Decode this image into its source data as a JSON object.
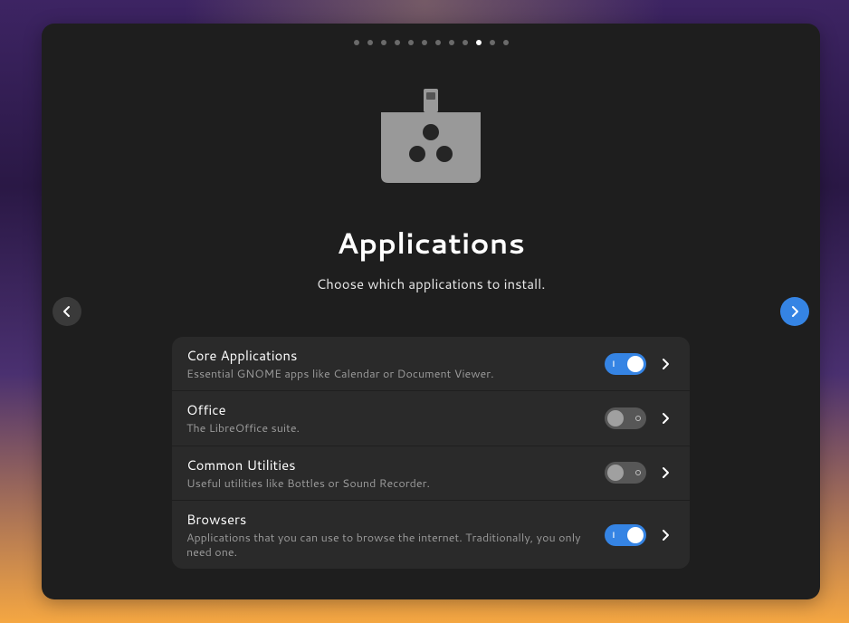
{
  "title": "Applications",
  "subtitle": "Choose which applications to install.",
  "page_indicator": {
    "total": 12,
    "active": 10
  },
  "rows": [
    {
      "title": "Core Applications",
      "desc": "Essential GNOME apps like Calendar or Document Viewer.",
      "enabled": true
    },
    {
      "title": "Office",
      "desc": "The LibreOffice suite.",
      "enabled": false
    },
    {
      "title": "Common Utilities",
      "desc": "Useful utilities like Bottles or Sound Recorder.",
      "enabled": false
    },
    {
      "title": "Browsers",
      "desc": "Applications that you can use to browse the internet. Traditionally, you only need one.",
      "enabled": true
    }
  ],
  "colors": {
    "accent": "#3584e4",
    "panel": "#1e1e1e",
    "row_bg": "#2a2a2a"
  }
}
